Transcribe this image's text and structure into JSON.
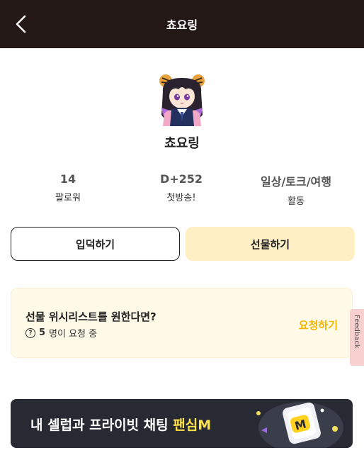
{
  "header": {
    "title": "쵸요링",
    "back_icon": "chevron-left-icon"
  },
  "profile": {
    "name": "쵸요링",
    "avatar": "avatar"
  },
  "stats": [
    {
      "value": "14",
      "label": "팔로워"
    },
    {
      "value": "D+252",
      "label": "첫방송!"
    },
    {
      "value": "일상/토크/여행",
      "label": "활동"
    }
  ],
  "actions": {
    "follow_label": "입덕하기",
    "gift_label": "선물하기"
  },
  "wishlist": {
    "title": "선물 위시리스트를 원한다면?",
    "count": "5",
    "count_suffix": "명이 요청 중",
    "action_label": "요청하기",
    "help_icon": "question-circle-icon"
  },
  "feedback": {
    "label": "Feedback"
  },
  "banner": {
    "text": "내 셀럽과 프라이빗 채팅",
    "highlight": "팬심M"
  },
  "colors": {
    "header_bg": "#231815",
    "accent": "#f5b400",
    "gift_bg": "#ffefc4",
    "wishlist_bg": "#fff9e8",
    "banner_bg": "#272a33",
    "banner_highlight": "#ffe24a"
  }
}
